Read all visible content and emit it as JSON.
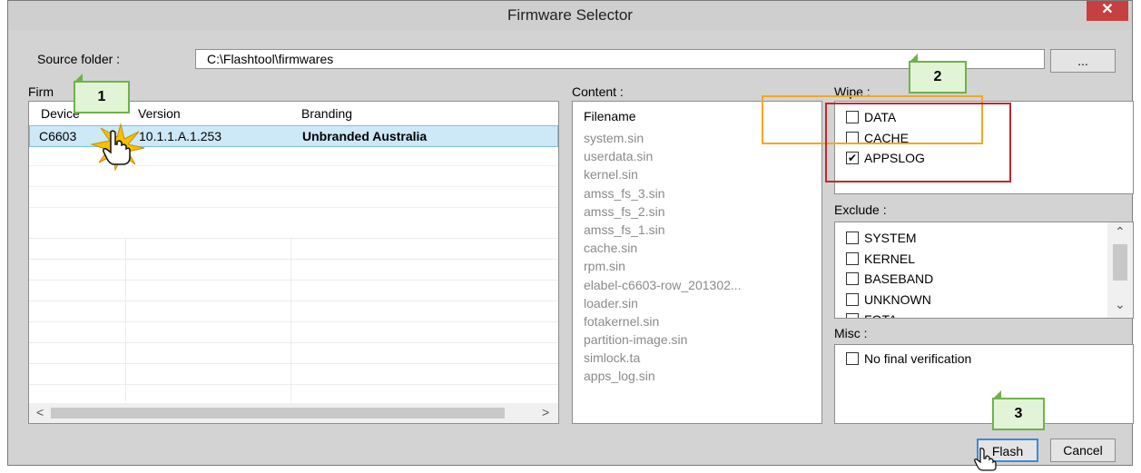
{
  "window": {
    "title": "Firmware Selector",
    "close_glyph": "✕"
  },
  "source": {
    "label": "Source folder :",
    "path": "C:\\Flashtool\\firmwares",
    "browse_label": "..."
  },
  "firmwares": {
    "label_partial": "Firm",
    "columns": [
      "Device",
      "Version",
      "Branding"
    ],
    "rows": [
      {
        "device": "C6603",
        "version": "10.1.1.A.1.253",
        "branding": "Unbranded Australia"
      }
    ],
    "scroll_left": "<",
    "scroll_right": ">"
  },
  "content": {
    "label": "Content :",
    "header": "Filename",
    "files": [
      "system.sin",
      "userdata.sin",
      "kernel.sin",
      "amss_fs_3.sin",
      "amss_fs_2.sin",
      "amss_fs_1.sin",
      "cache.sin",
      "rpm.sin",
      "elabel-c6603-row_201302...",
      "loader.sin",
      "fotakernel.sin",
      "partition-image.sin",
      "simlock.ta",
      "apps_log.sin"
    ]
  },
  "wipe": {
    "label": "Wipe :",
    "items": [
      {
        "label": "DATA",
        "checked": false
      },
      {
        "label": "CACHE",
        "checked": false
      },
      {
        "label": "APPSLOG",
        "checked": true
      }
    ]
  },
  "exclude": {
    "label": "Exclude :",
    "items": [
      {
        "label": "SYSTEM",
        "checked": false
      },
      {
        "label": "KERNEL",
        "checked": false
      },
      {
        "label": "BASEBAND",
        "checked": false
      },
      {
        "label": "UNKNOWN",
        "checked": false
      },
      {
        "label": "FOTA",
        "checked": false
      }
    ],
    "scroll_up": "⌃",
    "scroll_down": "⌄"
  },
  "misc": {
    "label": "Misc :",
    "items": [
      {
        "label": "No final verification",
        "checked": false
      }
    ]
  },
  "buttons": {
    "flash": "Flash",
    "cancel": "Cancel"
  },
  "callouts": {
    "one": "1",
    "two": "2",
    "three": "3"
  },
  "colors": {
    "callout_fill": "#e2f4d6",
    "callout_border": "#6fb24a",
    "orange_highlight": "#f5a623",
    "red_highlight": "#c0282d",
    "selection": "#cde8f7"
  },
  "icons": {
    "check": "✔",
    "pointer": "hand-pointer-icon",
    "click": "click-burst-icon"
  }
}
